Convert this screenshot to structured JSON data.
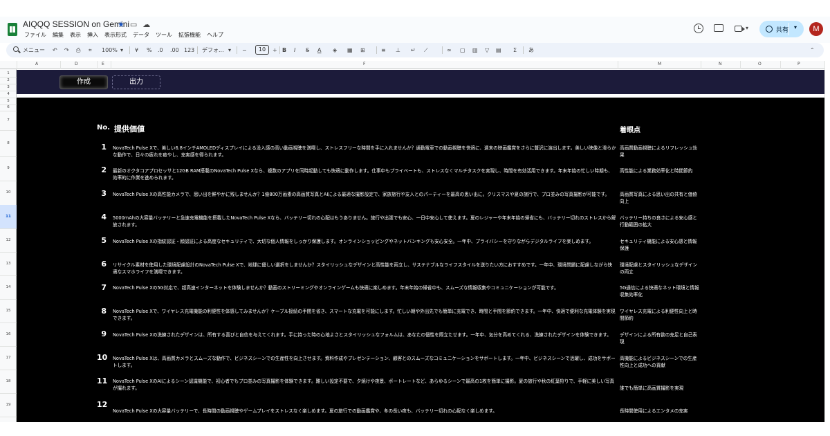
{
  "app": {
    "title": "AIQQQ SESSION on Gemini",
    "menu": [
      "ファイル",
      "編集",
      "表示",
      "挿入",
      "表示形式",
      "データ",
      "ツール",
      "拡張機能",
      "ヘルプ"
    ],
    "share_label": "共有",
    "avatar_initial": "M",
    "accent_color": "#c2e7ff"
  },
  "toolbar": {
    "search_label": "メニュー",
    "zoom": "100%",
    "currency": "¥",
    "percent": "%",
    "decimal_decrease": ".0",
    "decimal_increase": ".00",
    "number_format": "123",
    "font": "デフォ...",
    "font_size": "10",
    "minus": "−",
    "plus": "+"
  },
  "columns": [
    "A",
    "D",
    "E",
    "F",
    "M",
    "N",
    "O",
    "P"
  ],
  "rows": [
    "1",
    "2",
    "3",
    "4",
    "5",
    "6",
    "7",
    "8",
    "9",
    "10",
    "11",
    "12",
    "13",
    "14",
    "15",
    "16",
    "17",
    "18",
    "19"
  ],
  "selected_row": "11",
  "sheet": {
    "tab_create": "作成",
    "tab_output": "出力",
    "header_no": "No.",
    "header_value": "提供価値",
    "header_focus": "着眼点",
    "items": [
      {
        "no": "1",
        "text": "NovaTech Pulse Xで、美しい6.8インチAMOLEDディスプレイによる没入感の高い動画視聴を満喫し、ストレスフリーな時間を手に入れませんか？通勤電車での動画視聴を快適に、週末の映画鑑賞をさらに贅沢に演出します。美しい映像と滑らかな動作で、日々の疲れを癒やし、充実感を得られます。",
        "focus": "高画質動画視聴によるリフレッシュ効果"
      },
      {
        "no": "2",
        "text": "最新のオクタコアプロセッサと12GB RAM搭載のNovaTech Pulse Xなら、複数のアプリを同時起動しても快適に動作します。仕事中もプライベートも、ストレスなくマルチタスクを実現し、時間を有効活用できます。年末年始の忙しい時期も、効率的に作業を進められます。",
        "focus": "高性能による業務効率化と時間節約"
      },
      {
        "no": "3",
        "text": "NovaTech Pulse Xの高性能カメラで、思い出を鮮やかに残しませんか？1億800万画素の高画質写真とAIによる最適な撮影設定で、家族旅行や友人とのパーティーを最高の思い出に。クリスマスや夏の旅行で、プロ並みの写真撮影が可能です。",
        "focus": "高画質写真による思い出の共有と価値向上"
      },
      {
        "no": "4",
        "text": "5000mAhの大容量バッテリーと急速充電機能を搭載したNovaTech Pulse Xなら、バッテリー切れの心配はもうありません。旅行や出張でも安心、一日中安心して使えます。夏のレジャーや年末年始の帰省にも、バッテリー切れのストレスから解放されます。",
        "focus": "バッテリー持ちの良さによる安心感と行動範囲の拡大"
      },
      {
        "no": "5",
        "text": "NovaTech Pulse Xの指紋認証・顔認証による高度なセキュリティで、大切な個人情報をしっかり保護します。オンラインショッピングやネットバンキングも安心安全。一年中、プライバシーを守りながらデジタルライフを楽しめます。",
        "focus": "セキュリティ機能による安心感と情報保護"
      },
      {
        "no": "6",
        "text": "リサイクル素材を使用した環境配慮設計のNovaTech Pulse Xで、地球に優しい選択をしませんか？スタイリッシュなデザインと高性能を両立し、サステナブルなライフスタイルを送りたい方におすすめです。一年中、環境問題に配慮しながら快適なスマホライフを満喫できます。",
        "focus": "環境配慮とスタイリッシュなデザインの両立"
      },
      {
        "no": "7",
        "text": "NovaTech Pulse Xの5G対応で、超高速インターネットを体験しませんか？動画のストリーミングやオンラインゲームも快適に楽しめます。年末年始の帰省中も、スムーズな情報収集やコミュニケーションが可能です。",
        "focus": "5G通信による快適なネット環境と情報収集効率化"
      },
      {
        "no": "8",
        "text": "NovaTech Pulse Xで、ワイヤレス充電機能の利便性を体感してみませんか？ケーブル接続の手間を省き、スマートな充電を可能にします。忙しい朝や外出先でも簡単に充電でき、時間と手間を節約できます。一年中、快適で便利な充電体験を実現できます。",
        "focus": "ワイヤレス充電による利便性向上と時間節約"
      },
      {
        "no": "9",
        "text": "NovaTech Pulse Xの洗練されたデザインは、所有する喜びと自信を与えてくれます。手に持った時の心地よさとスタイリッシュなフォルムは、あなたの個性を際立たせます。一年中、気分を高めてくれる、洗練されたデザインを体験できます。",
        "focus": "デザインによる所有欲の充足と自己表現"
      },
      {
        "no": "10",
        "text": "NovaTech Pulse Xは、高画質カメラとスムーズな動作で、ビジネスシーンでの生産性を向上させます。資料作成やプレゼンテーション、顧客とのスムーズなコミュニケーションをサポートします。一年中、ビジネスシーンで活躍し、成功をサポートします。",
        "focus": "高機能によるビジネスシーンでの生産性向上と成功への貢献"
      },
      {
        "no": "11",
        "text": "NovaTech Pulse XのAIによるシーン認識機能で、初心者でもプロ並みの写真撮影を体験できます。難しい設定不要で、夕焼けや夜景、ポートレートなど、あらゆるシーンで最高の1枚を簡単に撮影。夏の旅行や秋の紅葉狩りで、手軽に美しい写真が撮れます。",
        "focus": "誰でも簡単に高画質撮影を実現"
      },
      {
        "no": "12",
        "text": "NovaTech Pulse Xの大容量バッテリーで、長時間の動画視聴やゲームプレイをストレスなく楽しめます。夏の旅行での動画鑑賞や、冬の長い夜も、バッテリー切れの心配なく楽しめます。",
        "focus": "長時間使用によるエンタメの充実"
      }
    ]
  }
}
